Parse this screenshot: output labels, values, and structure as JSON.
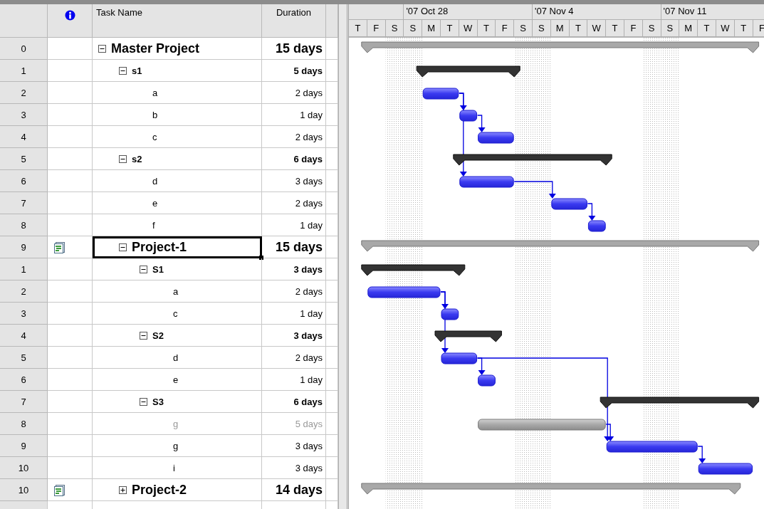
{
  "table": {
    "columns": [
      {
        "kind": "indicator"
      },
      {
        "kind": "name",
        "label": "Task Name"
      },
      {
        "kind": "duration",
        "label": "Duration"
      }
    ]
  },
  "tasks": [
    {
      "id": "0",
      "name": "Master Project",
      "duration": "15 days",
      "kind": "project",
      "inserted_project": false,
      "expanded": true,
      "selected": false,
      "children": [
        {
          "id": "1",
          "name": "s1",
          "duration": "5 days",
          "kind": "summary",
          "inserted_project": false,
          "expanded": true,
          "selected": false,
          "children": [
            {
              "id": "2",
              "name": "a",
              "duration": "2 days",
              "kind": "task",
              "inserted_project": false,
              "selected": false
            },
            {
              "id": "3",
              "name": "b",
              "duration": "1 day",
              "kind": "task",
              "inserted_project": false,
              "selected": false
            },
            {
              "id": "4",
              "name": "c",
              "duration": "2 days",
              "kind": "task",
              "inserted_project": false,
              "selected": false
            }
          ]
        },
        {
          "id": "5",
          "name": "s2",
          "duration": "6 days",
          "kind": "summary",
          "inserted_project": false,
          "expanded": true,
          "selected": false,
          "children": [
            {
              "id": "6",
              "name": "d",
              "duration": "3 days",
              "kind": "task",
              "inserted_project": false,
              "selected": false
            },
            {
              "id": "7",
              "name": "e",
              "duration": "2 days",
              "kind": "task",
              "inserted_project": false,
              "selected": false
            },
            {
              "id": "8",
              "name": "f",
              "duration": "1 day",
              "kind": "task",
              "inserted_project": false,
              "selected": false
            }
          ]
        },
        {
          "id": "9",
          "name": "Project-1",
          "duration": "15 days",
          "kind": "project",
          "inserted_project": true,
          "expanded": true,
          "selected": true,
          "children": [
            {
              "id": "1",
              "name": "S1",
              "duration": "3 days",
              "kind": "summary",
              "inserted_project": false,
              "expanded": true,
              "selected": false,
              "children": [
                {
                  "id": "2",
                  "name": "a",
                  "duration": "2 days",
                  "kind": "task",
                  "inserted_project": false,
                  "selected": false
                },
                {
                  "id": "3",
                  "name": "c",
                  "duration": "1 day",
                  "kind": "task",
                  "inserted_project": false,
                  "selected": false
                }
              ]
            },
            {
              "id": "4",
              "name": "S2",
              "duration": "3 days",
              "kind": "summary",
              "inserted_project": false,
              "expanded": true,
              "selected": false,
              "children": [
                {
                  "id": "5",
                  "name": "d",
                  "duration": "2 days",
                  "kind": "task",
                  "inserted_project": false,
                  "selected": false
                },
                {
                  "id": "6",
                  "name": "e",
                  "duration": "1 day",
                  "kind": "task",
                  "inserted_project": false,
                  "selected": false
                }
              ]
            },
            {
              "id": "7",
              "name": "S3",
              "duration": "6 days",
              "kind": "summary",
              "inserted_project": false,
              "expanded": true,
              "selected": false,
              "children": [
                {
                  "id": "8",
                  "name": "g",
                  "duration": "5 days",
                  "kind": "inactive",
                  "inserted_project": false,
                  "selected": false
                },
                {
                  "id": "9",
                  "name": "g",
                  "duration": "3 days",
                  "kind": "task",
                  "inserted_project": false,
                  "selected": false
                },
                {
                  "id": "10",
                  "name": "i",
                  "duration": "3 days",
                  "kind": "task",
                  "inserted_project": false,
                  "selected": false
                }
              ]
            }
          ]
        },
        {
          "id": "10",
          "name": "Project-2",
          "duration": "14 days",
          "kind": "project",
          "inserted_project": true,
          "expanded": false,
          "selected": false
        }
      ]
    }
  ],
  "timescale": {
    "weeks": [
      {
        "days": [
          {
            "label": "T",
            "nonworking": false
          },
          {
            "label": "F",
            "nonworking": false
          },
          {
            "label": "S",
            "nonworking": true
          }
        ]
      },
      {
        "label": "'07 Oct 28",
        "days": [
          {
            "label": "S",
            "nonworking": true
          },
          {
            "label": "M",
            "nonworking": false
          },
          {
            "label": "T",
            "nonworking": false
          },
          {
            "label": "W",
            "nonworking": false
          },
          {
            "label": "T",
            "nonworking": false
          },
          {
            "label": "F",
            "nonworking": false
          },
          {
            "label": "S",
            "nonworking": true
          }
        ]
      },
      {
        "label": "'07 Nov 4",
        "days": [
          {
            "label": "S",
            "nonworking": true
          },
          {
            "label": "M",
            "nonworking": false
          },
          {
            "label": "T",
            "nonworking": false
          },
          {
            "label": "W",
            "nonworking": false
          },
          {
            "label": "T",
            "nonworking": false
          },
          {
            "label": "F",
            "nonworking": false
          },
          {
            "label": "S",
            "nonworking": true
          }
        ]
      },
      {
        "label": "'07 Nov 11",
        "days": [
          {
            "label": "S",
            "nonworking": true
          },
          {
            "label": "M",
            "nonworking": false
          },
          {
            "label": "T",
            "nonworking": false
          },
          {
            "label": "W",
            "nonworking": false
          },
          {
            "label": "T",
            "nonworking": false
          },
          {
            "label": "F",
            "nonworking": false
          }
        ]
      }
    ]
  }
}
